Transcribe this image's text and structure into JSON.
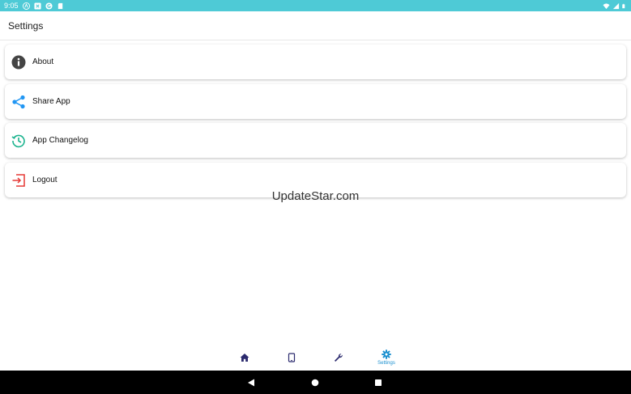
{
  "status_bar": {
    "time": "9:05",
    "icons": [
      "autoupdate-a-icon",
      "x-icon",
      "g-icon",
      "sd-card-icon"
    ],
    "right_icons": [
      "wifi-icon",
      "signal-icon",
      "battery-icon"
    ]
  },
  "app_bar": {
    "title": "Settings"
  },
  "settings": {
    "items": [
      {
        "label": "About",
        "icon": "info-icon",
        "color": "#444444"
      },
      {
        "label": "Share App",
        "icon": "share-icon",
        "color": "#2196f3"
      },
      {
        "label": "App Changelog",
        "icon": "history-icon",
        "color": "#1bb38e"
      },
      {
        "label": "Logout",
        "icon": "logout-icon",
        "color": "#e53935"
      }
    ]
  },
  "watermark": "UpdateStar.com",
  "bottom_nav": {
    "items": [
      {
        "icon": "home-icon",
        "label": ""
      },
      {
        "icon": "tablet-icon",
        "label": ""
      },
      {
        "icon": "wrench-icon",
        "label": ""
      },
      {
        "icon": "gear-icon",
        "label": "Settings",
        "active": true
      }
    ],
    "active_color": "#1a8fcf",
    "inactive_color": "#2b2a6e"
  },
  "colors": {
    "status_bar": "#4ecad6",
    "system_nav": "#000000"
  }
}
